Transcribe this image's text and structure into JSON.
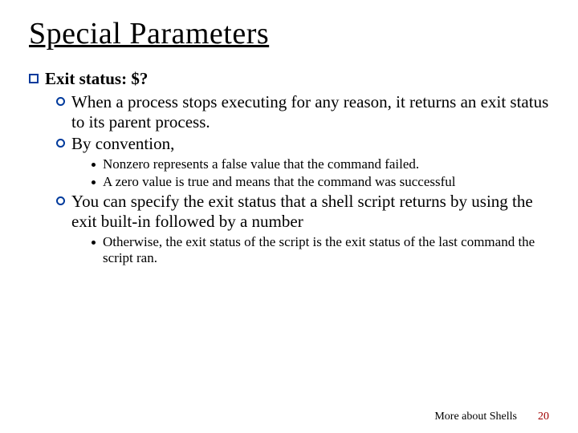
{
  "title": "Special Parameters",
  "section": {
    "heading": "Exit status: $?",
    "items": [
      {
        "text": "When a process stops executing for any reason, it returns an exit status to its parent process."
      },
      {
        "text": "By convention,",
        "sub": [
          "Nonzero represents a false value that the command failed.",
          "A zero value is true and means that the command was successful"
        ]
      },
      {
        "text": "You can specify the exit status that a shell script returns by using the exit built-in followed by a number",
        "sub": [
          "Otherwise, the exit status of the script is the exit status of the last command the script ran."
        ]
      }
    ]
  },
  "footer": {
    "text": "More about Shells",
    "page": "20"
  }
}
